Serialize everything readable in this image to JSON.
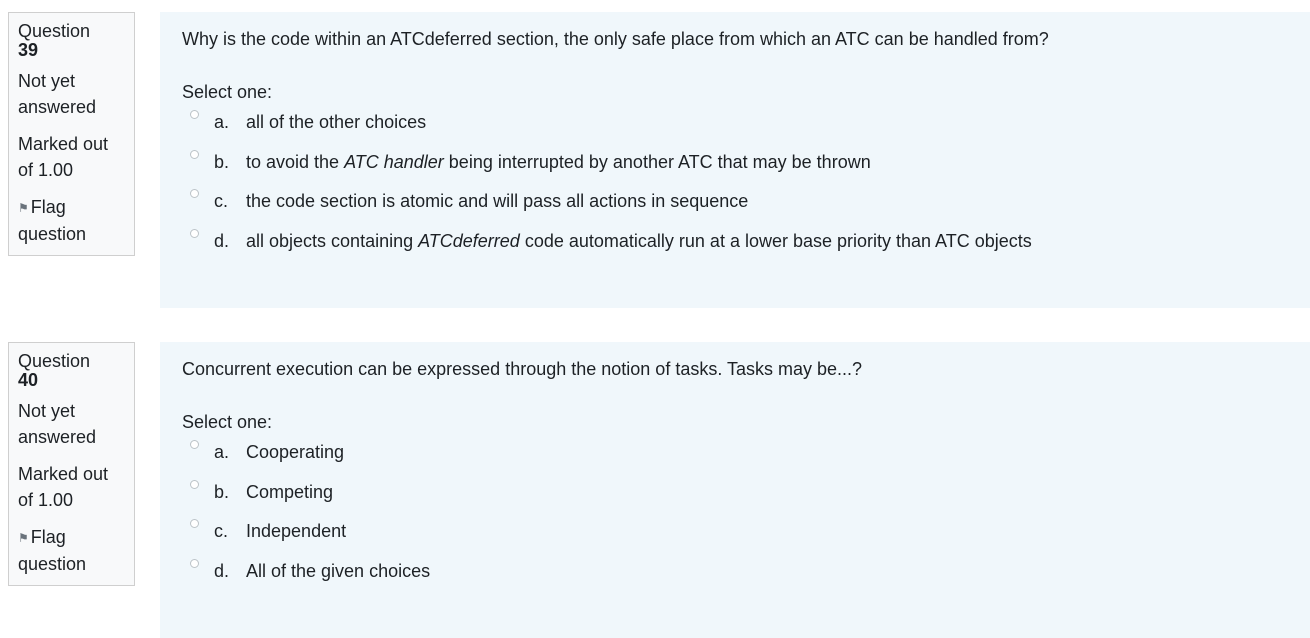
{
  "questions": [
    {
      "label": "Question",
      "number": "39",
      "state": "Not yet answered",
      "grade": "Marked out of 1.00",
      "flag": "Flag question",
      "text": "Why is the code within an ATCdeferred section, the only safe place from which an ATC can be handled from?",
      "prompt": "Select one:",
      "options": [
        {
          "letter": "a.",
          "pre": "all of the other choices",
          "em": "",
          "post": ""
        },
        {
          "letter": "b.",
          "pre": "to avoid the ",
          "em": "ATC handler",
          "post": " being interrupted by another ATC that may be thrown"
        },
        {
          "letter": "c.",
          "pre": "the code section is atomic and will pass all actions in sequence",
          "em": "",
          "post": ""
        },
        {
          "letter": "d.",
          "pre": "all objects containing ",
          "em": "ATCdeferred",
          "post": " code automatically run at a lower base priority than ATC objects"
        }
      ]
    },
    {
      "label": "Question",
      "number": "40",
      "state": "Not yet answered",
      "grade": "Marked out of 1.00",
      "flag": "Flag question",
      "text": "Concurrent execution can be expressed through the notion of tasks.  Tasks may be...?",
      "prompt": "Select one:",
      "options": [
        {
          "letter": "a.",
          "pre": "Cooperating",
          "em": "",
          "post": ""
        },
        {
          "letter": "b.",
          "pre": "Competing",
          "em": "",
          "post": ""
        },
        {
          "letter": "c.",
          "pre": "Independent",
          "em": "",
          "post": ""
        },
        {
          "letter": "d.",
          "pre": "All of the given choices",
          "em": "",
          "post": ""
        }
      ]
    }
  ],
  "icons": {
    "flag": "flag-icon"
  },
  "colors": {
    "panel": "#f0f7fb",
    "info_bg": "#f8f9fa",
    "info_border": "#cfcfcf",
    "text": "#1d2125"
  }
}
